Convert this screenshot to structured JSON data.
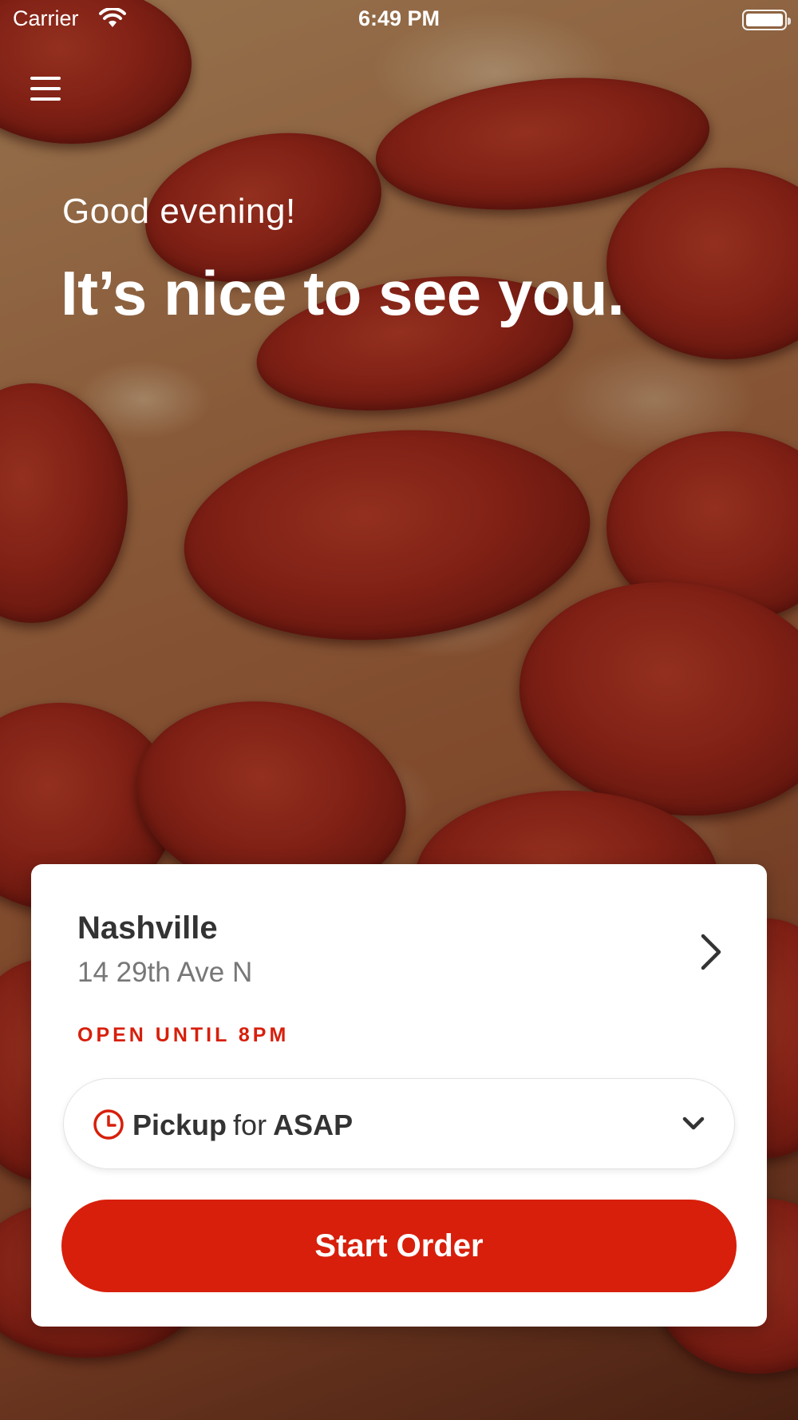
{
  "status_bar": {
    "carrier": "Carrier",
    "time": "6:49 PM"
  },
  "greeting": {
    "salutation": "Good evening!",
    "headline": "It’s nice to see you."
  },
  "store": {
    "name": "Nashville",
    "address": "14 29th Ave N",
    "hours_status": "OPEN UNTIL 8PM"
  },
  "order_time": {
    "mode": "Pickup",
    "connector": "for",
    "time": "ASAP"
  },
  "actions": {
    "start_order_label": "Start Order"
  },
  "theme": {
    "accent": "#d71f0b",
    "card_background": "#ffffff",
    "text_primary": "#333333",
    "text_secondary": "#777777"
  },
  "icons": {
    "menu": "hamburger-menu-icon",
    "store_arrow": "chevron-right-icon",
    "time": "clock-icon",
    "dropdown": "chevron-down-icon"
  }
}
